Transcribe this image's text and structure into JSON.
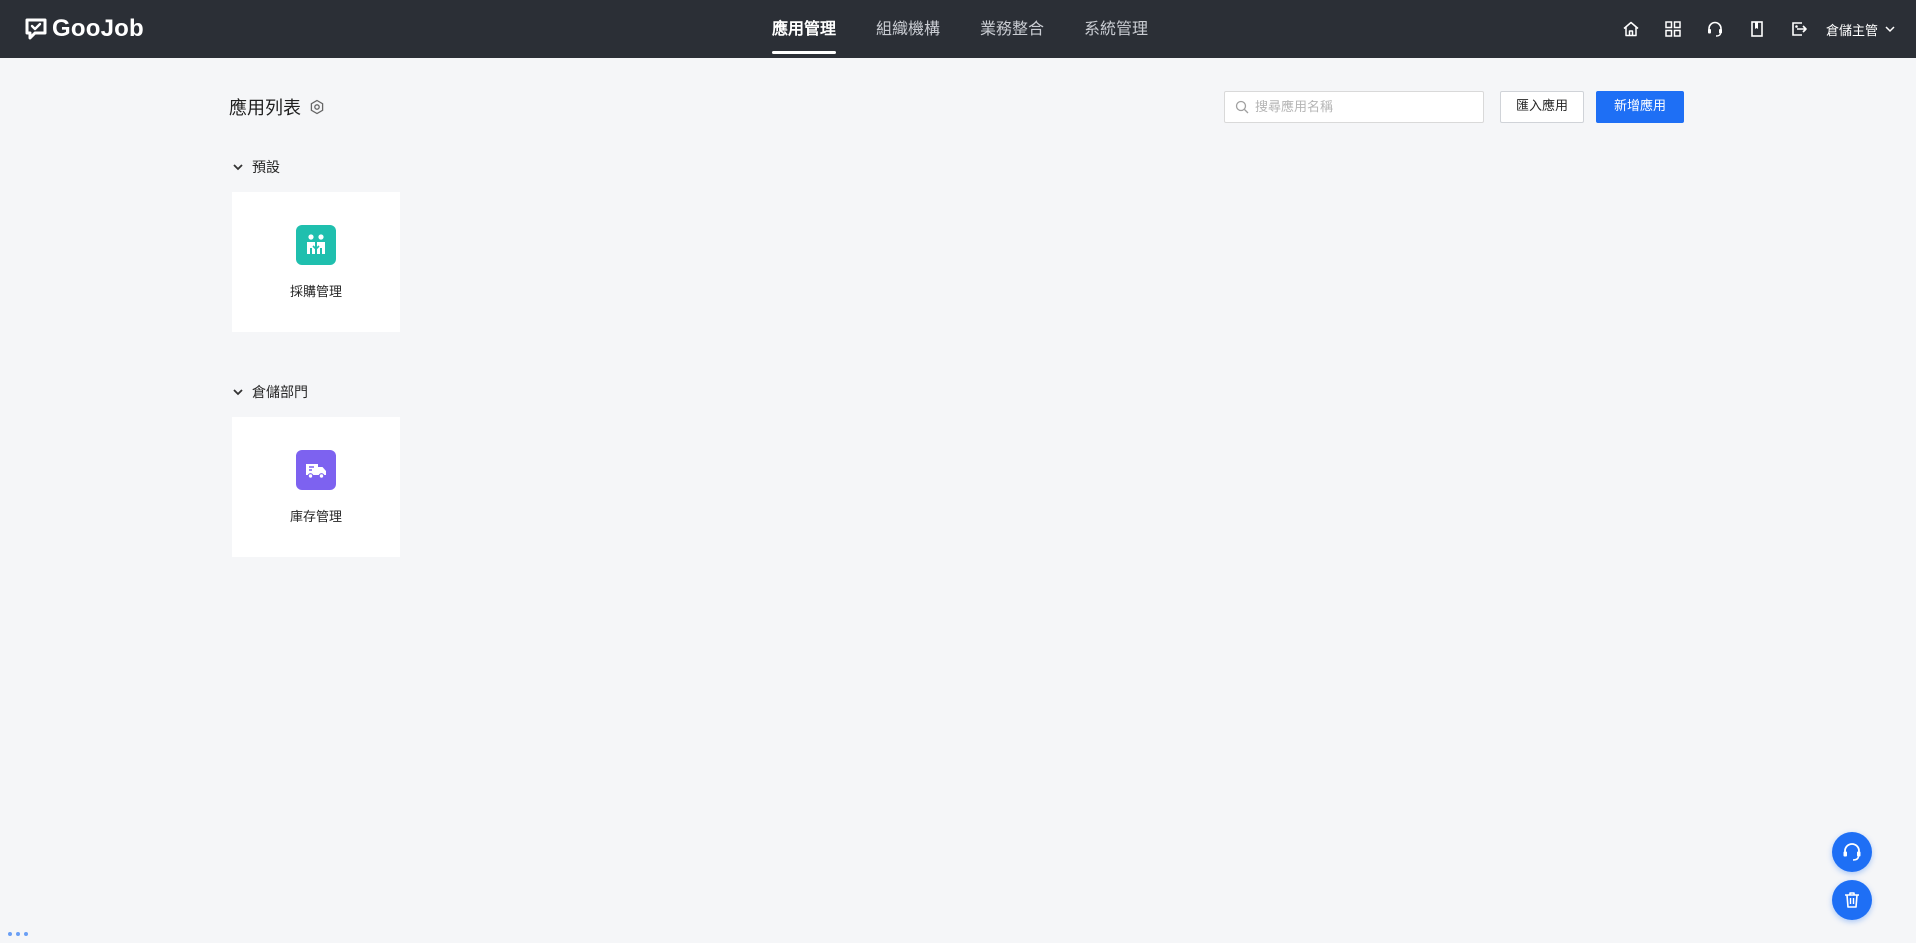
{
  "brand": {
    "logo_text": "GooJob"
  },
  "nav": {
    "items": [
      {
        "label": "應用管理",
        "active": true
      },
      {
        "label": "組織機構",
        "active": false
      },
      {
        "label": "業務整合",
        "active": false
      },
      {
        "label": "系統管理",
        "active": false
      }
    ]
  },
  "header_icons": [
    "home-icon",
    "grid-apps-icon",
    "support-icon",
    "book-icon",
    "export-icon"
  ],
  "user": {
    "name": "倉儲主管"
  },
  "page": {
    "title": "應用列表",
    "search_placeholder": "搜尋應用名稱",
    "import_label": "匯入應用",
    "new_label": "新增應用"
  },
  "groups": [
    {
      "name": "預設",
      "apps": [
        {
          "name": "採購管理",
          "icon": "handshake-icon",
          "color": "#1fbfae"
        }
      ]
    },
    {
      "name": "倉儲部門",
      "apps": [
        {
          "name": "庫存管理",
          "icon": "truck-icon",
          "color": "#7d62f0"
        }
      ]
    }
  ],
  "colors": {
    "topbar": "#2b2f36",
    "primary": "#1e6ff5",
    "background": "#f5f6f8"
  }
}
